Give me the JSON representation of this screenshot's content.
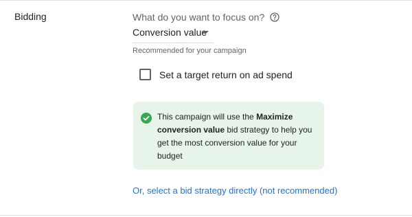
{
  "section": {
    "label": "Bidding"
  },
  "focus": {
    "question": "What do you want to focus on?",
    "help_icon": "help-circle-icon",
    "selected_value": "Conversion value",
    "helper_text": "Recommended for your campaign"
  },
  "target_roas": {
    "label": "Set a target return on ad spend",
    "checked": false
  },
  "info": {
    "icon": "check-circle-icon",
    "text_before": "This campaign will use the ",
    "strategy_name": "Maximize conversion value",
    "text_after": " bid strategy to help you get the most conversion value for your budget"
  },
  "link": {
    "label": "Or, select a bid strategy directly (not recommended)"
  },
  "colors": {
    "accent": "#1a73e8",
    "success": "#34a853",
    "info_background": "#e6f4ea",
    "secondary_text": "#5f6368"
  }
}
